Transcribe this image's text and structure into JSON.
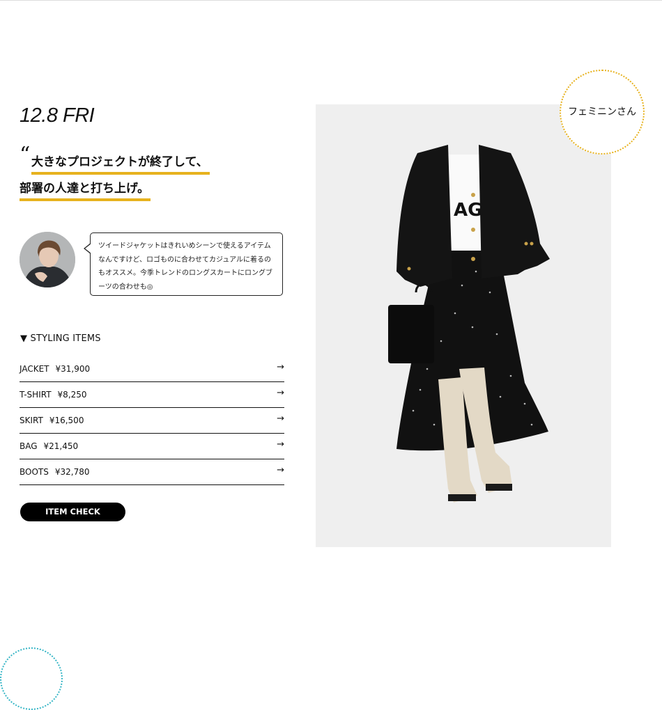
{
  "date": "12.8 FRI",
  "quote_mark": "“",
  "headline": {
    "line1": "大きなプロジェクトが終了して、",
    "line2": "部署の人達と打ち上げ。"
  },
  "comment": "ツイードジャケットはきれいめシーンで使えるアイテムなんですけど、ロゴものに合わせてカジュアルに着るのもオススメ。今季トレンドのロングスカートにロングブーツの合わせも◎",
  "styling_heading": "▼ STYLING ITEMS",
  "items": [
    {
      "name": "JACKET",
      "price": "¥31,900",
      "arrow": "→"
    },
    {
      "name": "T-SHIRT",
      "price": "¥8,250",
      "arrow": "→"
    },
    {
      "name": "SKIRT",
      "price": "¥16,500",
      "arrow": "→"
    },
    {
      "name": "BAG",
      "price": "¥21,450",
      "arrow": "→"
    },
    {
      "name": "BOOTS",
      "price": "¥32,780",
      "arrow": "→"
    }
  ],
  "item_check_label": "ITEM CHECK",
  "badge": "フェミニンさん",
  "tshirt_print": "AGE",
  "colors": {
    "accent": "#e7b21e",
    "deco": "#37b6c6",
    "button": "#000000"
  }
}
